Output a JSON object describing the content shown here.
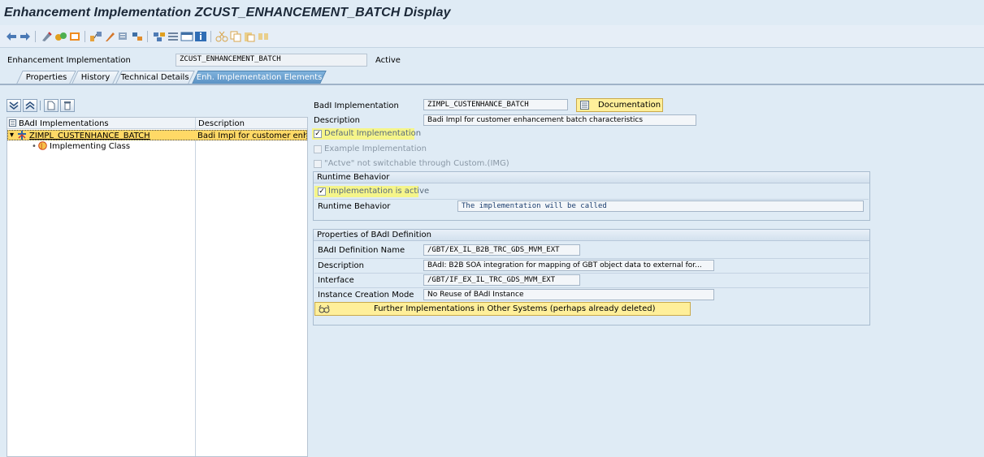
{
  "window": {
    "title": "Enhancement Implementation ZCUST_ENHANCEMENT_BATCH Display"
  },
  "header": {
    "label": "Enhancement Implementation",
    "value": "ZCUST_ENHANCEMENT_BATCH",
    "status": "Active"
  },
  "tabs": [
    {
      "label": "Properties"
    },
    {
      "label": "History"
    },
    {
      "label": "Technical Details"
    },
    {
      "label": "Enh. Implementation Elements"
    }
  ],
  "tree": {
    "col1": "BAdI Implementations",
    "col2": "Description",
    "rows": [
      {
        "name": "ZIMPL_CUSTENHANCE_BATCH",
        "desc": "Badi Impl for customer enhanc"
      },
      {
        "name": "Implementing Class",
        "desc": ""
      }
    ]
  },
  "form": {
    "badi_impl_label": "BadI Implementation",
    "badi_impl_value": "ZIMPL_CUSTENHANCE_BATCH",
    "doc_button": "Documentation",
    "desc_label": "Description",
    "desc_value": "Badi Impl for customer enhancement batch characteristics",
    "default_impl": "Default Implementation",
    "example_impl": "Example Implementation",
    "not_switchable": "\"Actve\" not switchable through Custom.(IMG)"
  },
  "runtime": {
    "title": "Runtime Behavior",
    "impl_active": "Implementation is active",
    "behavior_label": "Runtime Behavior",
    "behavior_value": "The implementation will be called"
  },
  "badi_def": {
    "title": "Properties of BAdI Definition",
    "name_label": "BAdI Definition Name",
    "name_value": "/GBT/EX_IL_B2B_TRC_GDS_MVM_EXT",
    "desc_label": "Description",
    "desc_value": "BAdI: B2B SOA integration for mapping of GBT object data to external for...",
    "iface_label": "Interface",
    "iface_value": "/GBT/IF_EX_IL_TRC_GDS_MVM_EXT",
    "mode_label": "Instance Creation Mode",
    "mode_value": "No Reuse of BAdI Instance",
    "further_button": "Further Implementations in Other Systems (perhaps already deleted)"
  }
}
